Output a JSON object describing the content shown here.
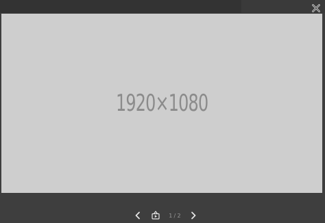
{
  "viewer": {
    "image_placeholder_text": "1920×1080",
    "counter": {
      "current": "1",
      "separator": "/",
      "total": "2"
    },
    "icons": {
      "close": "close-icon",
      "prev": "chevron-left-icon",
      "play": "slideshow-play-icon",
      "next": "chevron-right-icon"
    },
    "colors": {
      "background": "#3e3e3e",
      "stage": "#cecece",
      "placeholder_text": "#8b8b8b",
      "icon": "#e6e6e6"
    }
  }
}
